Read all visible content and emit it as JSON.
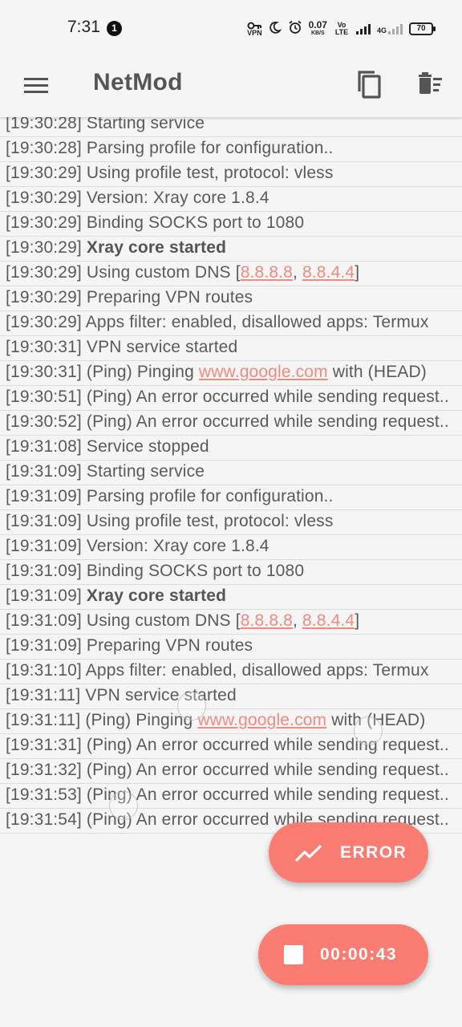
{
  "status_bar": {
    "time": "7:31",
    "notification_count": "1",
    "data_rate_value": "0.07",
    "data_rate_unit": "KB/S",
    "vpn_label": "VPN",
    "volte_label": "Vo LTE",
    "network_type": "4G",
    "battery": "70",
    "icons": [
      "vpn-key-icon",
      "moon-icon",
      "alarm-icon",
      "signal-icon",
      "battery-icon"
    ]
  },
  "app_bar": {
    "title": "NetMod",
    "icons": [
      "menu-icon",
      "copy-icon",
      "clear-log-icon"
    ]
  },
  "colors": {
    "accent": "#fb7c72",
    "link": "#f28a80",
    "text": "#5a5a5a",
    "background": "#f5f5f5"
  },
  "log": [
    {
      "time": "[19:30:28]",
      "text": "Starting service"
    },
    {
      "time": "[19:30:28]",
      "text": "Parsing profile for configuration.."
    },
    {
      "time": "[19:30:29]",
      "text": "Using profile test, protocol: vless"
    },
    {
      "time": "[19:30:29]",
      "text": "Version: Xray core 1.8.4"
    },
    {
      "time": "[19:30:29]",
      "text": "Binding SOCKS port to 1080"
    },
    {
      "time": "[19:30:29]",
      "bold": "Xray core started"
    },
    {
      "time": "[19:30:29]",
      "text": "Using custom DNS [",
      "links": [
        "8.8.8.8",
        "8.8.4.4"
      ],
      "after": "]"
    },
    {
      "time": "[19:30:29]",
      "text": "Preparing VPN routes"
    },
    {
      "time": "[19:30:29]",
      "text": "Apps filter: enabled, disallowed apps: Termux"
    },
    {
      "time": "[19:30:31]",
      "text": "VPN service started"
    },
    {
      "time": "[19:30:31]",
      "text": "(Ping) Pinging ",
      "links": [
        "www.google.com"
      ],
      "after": " with (HEAD)"
    },
    {
      "time": "[19:30:51]",
      "text": "(Ping) An error occurred while sending request.."
    },
    {
      "time": "[19:30:52]",
      "text": "(Ping) An error occurred while sending request.."
    },
    {
      "time": "[19:31:08]",
      "text": "Service stopped"
    },
    {
      "time": "[19:31:09]",
      "text": "Starting service"
    },
    {
      "time": "[19:31:09]",
      "text": "Parsing profile for configuration.."
    },
    {
      "time": "[19:31:09]",
      "text": "Using profile test, protocol: vless"
    },
    {
      "time": "[19:31:09]",
      "text": "Version: Xray core 1.8.4"
    },
    {
      "time": "[19:31:09]",
      "text": "Binding SOCKS port to 1080"
    },
    {
      "time": "[19:31:09]",
      "bold": "Xray core started"
    },
    {
      "time": "[19:31:09]",
      "text": "Using custom DNS [",
      "links": [
        "8.8.8.8",
        "8.8.4.4"
      ],
      "after": "]"
    },
    {
      "time": "[19:31:09]",
      "text": "Preparing VPN routes"
    },
    {
      "time": "[19:31:10]",
      "text": "Apps filter: enabled, disallowed apps: Termux"
    },
    {
      "time": "[19:31:11]",
      "text": "VPN service started"
    },
    {
      "time": "[19:31:11]",
      "text": "(Ping) Pinging ",
      "links": [
        "www.google.com"
      ],
      "after": " with (HEAD)"
    },
    {
      "time": "[19:31:31]",
      "text": "(Ping) An error occurred while sending request.."
    },
    {
      "time": "[19:31:32]",
      "text": "(Ping) An error occurred while sending request.."
    },
    {
      "time": "[19:31:53]",
      "text": "(Ping) An error occurred while sending request.."
    },
    {
      "time": "[19:31:54]",
      "text": "(Ping) An error occurred while sending request.."
    }
  ],
  "fab_error": {
    "label": "ERROR",
    "icon": "trending-up-icon"
  },
  "fab_timer": {
    "label": "00:00:43",
    "icon": "stop-icon"
  }
}
